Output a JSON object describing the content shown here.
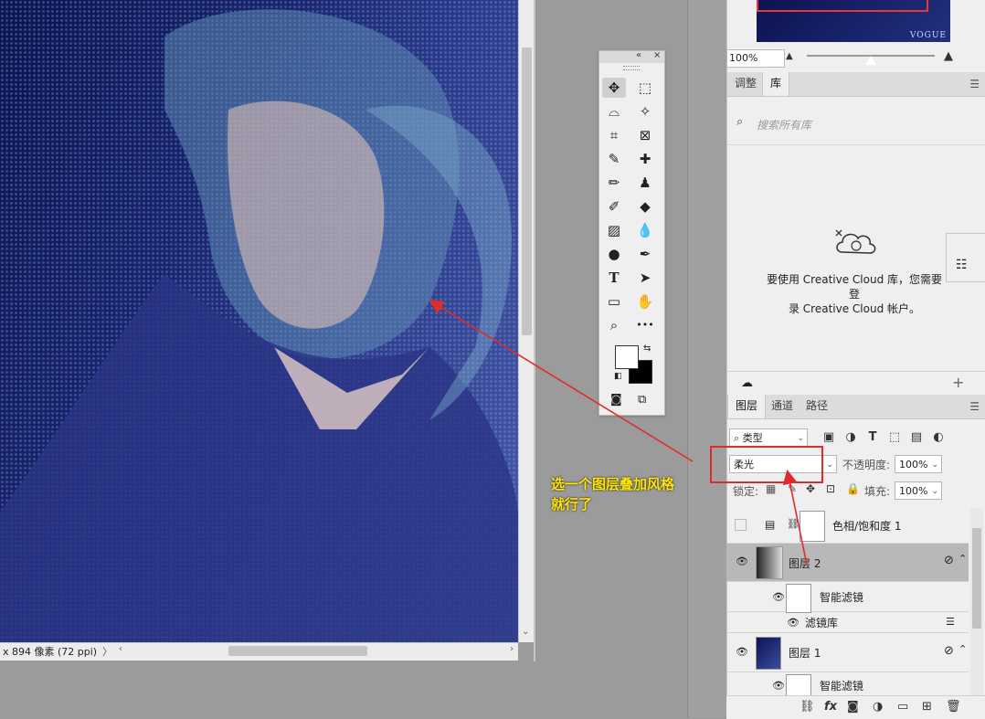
{
  "canvas": {
    "status_text": "x 894 像素 (72 ppi)",
    "nav_arrow": "〉",
    "hscroll_left": "‹",
    "hscroll_right": "›",
    "vscroll_down": "⌄"
  },
  "toolbar": {
    "collapse": "«",
    "close": "×",
    "tools": [
      {
        "icon": "move-icon",
        "glyph": "✥"
      },
      {
        "icon": "marquee-icon",
        "glyph": "⬚"
      },
      {
        "icon": "lasso-icon",
        "glyph": "⌓"
      },
      {
        "icon": "magic-wand-icon",
        "glyph": "✧"
      },
      {
        "icon": "crop-icon",
        "glyph": "⌗"
      },
      {
        "icon": "frame-icon",
        "glyph": "⊠"
      },
      {
        "icon": "eyedropper-icon",
        "glyph": "✎"
      },
      {
        "icon": "healing-brush-icon",
        "glyph": "✚"
      },
      {
        "icon": "brush-icon",
        "glyph": "✏"
      },
      {
        "icon": "stamp-icon",
        "glyph": "♟"
      },
      {
        "icon": "history-brush-icon",
        "glyph": "✐"
      },
      {
        "icon": "eraser-icon",
        "glyph": "◆"
      },
      {
        "icon": "gradient-icon",
        "glyph": "▨"
      },
      {
        "icon": "blur-icon",
        "glyph": "💧"
      },
      {
        "icon": "dodge-icon",
        "glyph": "●"
      },
      {
        "icon": "pen-icon",
        "glyph": "✒"
      },
      {
        "icon": "type-icon",
        "glyph": "T"
      },
      {
        "icon": "path-selection-icon",
        "glyph": "➤"
      },
      {
        "icon": "rectangle-icon",
        "glyph": "▭"
      },
      {
        "icon": "hand-icon",
        "glyph": "✋"
      },
      {
        "icon": "zoom-icon",
        "glyph": "⌕"
      },
      {
        "icon": "more-icon",
        "glyph": "•••"
      }
    ],
    "fg_color": "#ffffff",
    "bg_color": "#000000"
  },
  "navigator": {
    "zoom": "100%",
    "vogue": "VOGUE"
  },
  "libraries": {
    "tabs": [
      "调整",
      "库"
    ],
    "active_tab": "库",
    "search_placeholder": "搜索所有库",
    "message_line1": "要使用 Creative Cloud 库，您需要登",
    "message_line2": "录 Creative Cloud 帐户。"
  },
  "layers": {
    "tabs": [
      "图层",
      "通道",
      "路径"
    ],
    "filter_label": "类型",
    "blend_mode": "柔光",
    "opacity_label": "不透明度:",
    "opacity_value": "100%",
    "lock_label": "锁定:",
    "fill_label": "填充:",
    "fill_value": "100%",
    "items": [
      {
        "name": "色相/饱和度 1",
        "visible": false
      },
      {
        "name": "图层 2",
        "visible": true,
        "selected": true
      },
      {
        "name": "智能滤镜",
        "visible": true
      },
      {
        "name": "滤镜库",
        "visible": true
      },
      {
        "name": "图层 1",
        "visible": true
      },
      {
        "name": "智能滤镜",
        "visible": true
      }
    ]
  },
  "annotation": {
    "line1": "选一个图层叠加风格",
    "line2": "就行了",
    "color": "#ffe600",
    "box_color": "#e02b2b"
  }
}
